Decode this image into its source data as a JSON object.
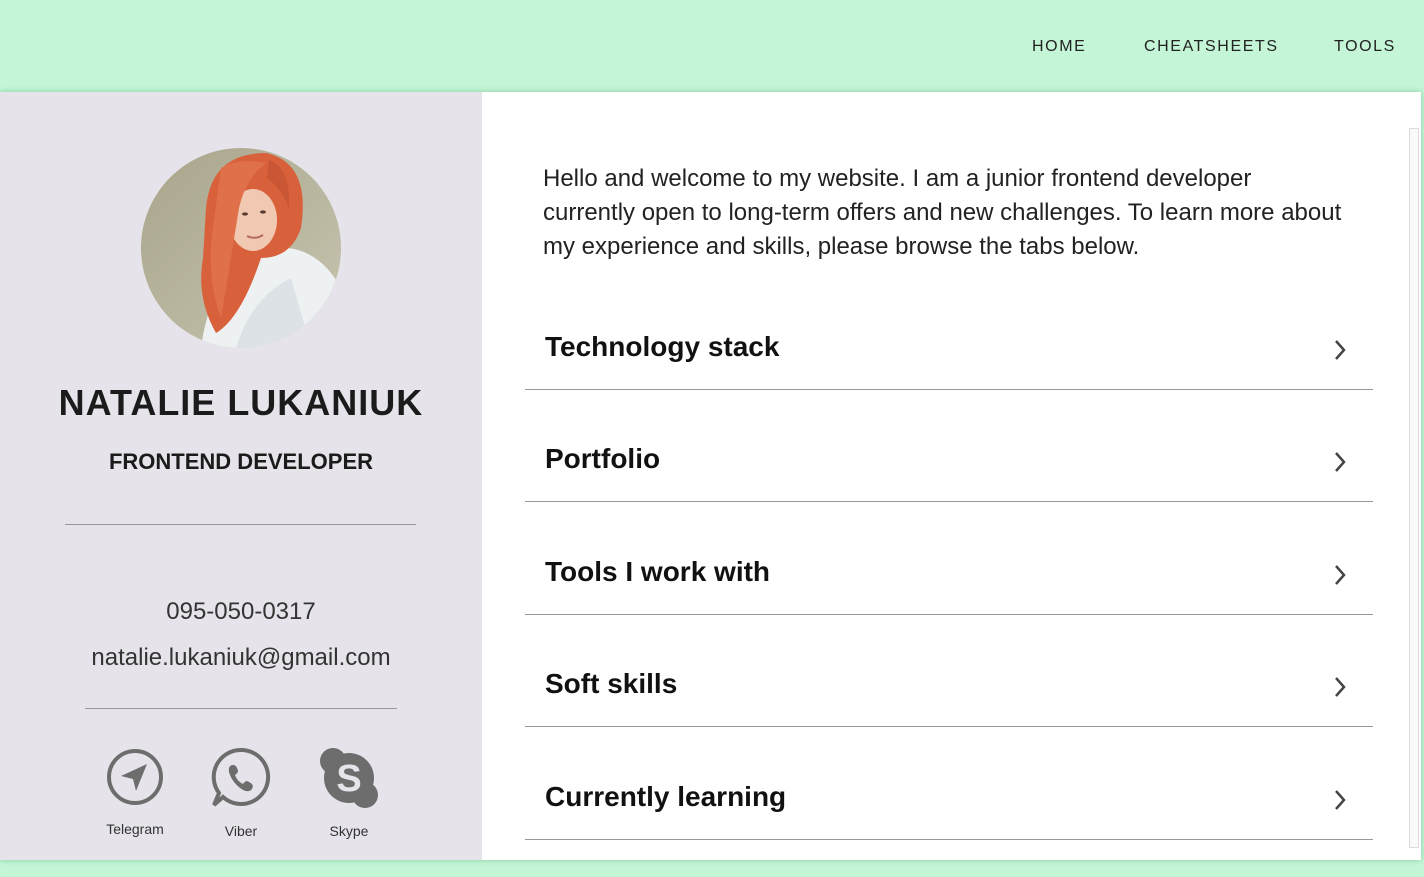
{
  "nav": {
    "home": "HOME",
    "cheatsheets": "CHEATSHEETS",
    "tools": "TOOLS"
  },
  "profile": {
    "name": "NATALIE LUKANIUK",
    "role": "FRONTEND DEVELOPER",
    "phone": "095-050-0317",
    "email": "natalie.lukaniuk@gmail.com",
    "social": [
      {
        "label": "Telegram",
        "icon": "telegram-icon"
      },
      {
        "label": "Viber",
        "icon": "viber-icon"
      },
      {
        "label": "Skype",
        "icon": "skype-icon"
      }
    ]
  },
  "main": {
    "intro": "Hello and welcome to my website. I am a junior frontend developer currently open to long-term offers and new challenges. To learn more about my experience and skills, please browse the tabs below.",
    "sections": [
      {
        "label": "Technology stack"
      },
      {
        "label": "Portfolio"
      },
      {
        "label": "Tools I work with"
      },
      {
        "label": "Soft skills"
      },
      {
        "label": "Currently learning"
      }
    ]
  },
  "colors": {
    "background": "#c4f5d6",
    "sidebar": "#e6e4ea",
    "icon_gray": "#6d6d6d"
  }
}
